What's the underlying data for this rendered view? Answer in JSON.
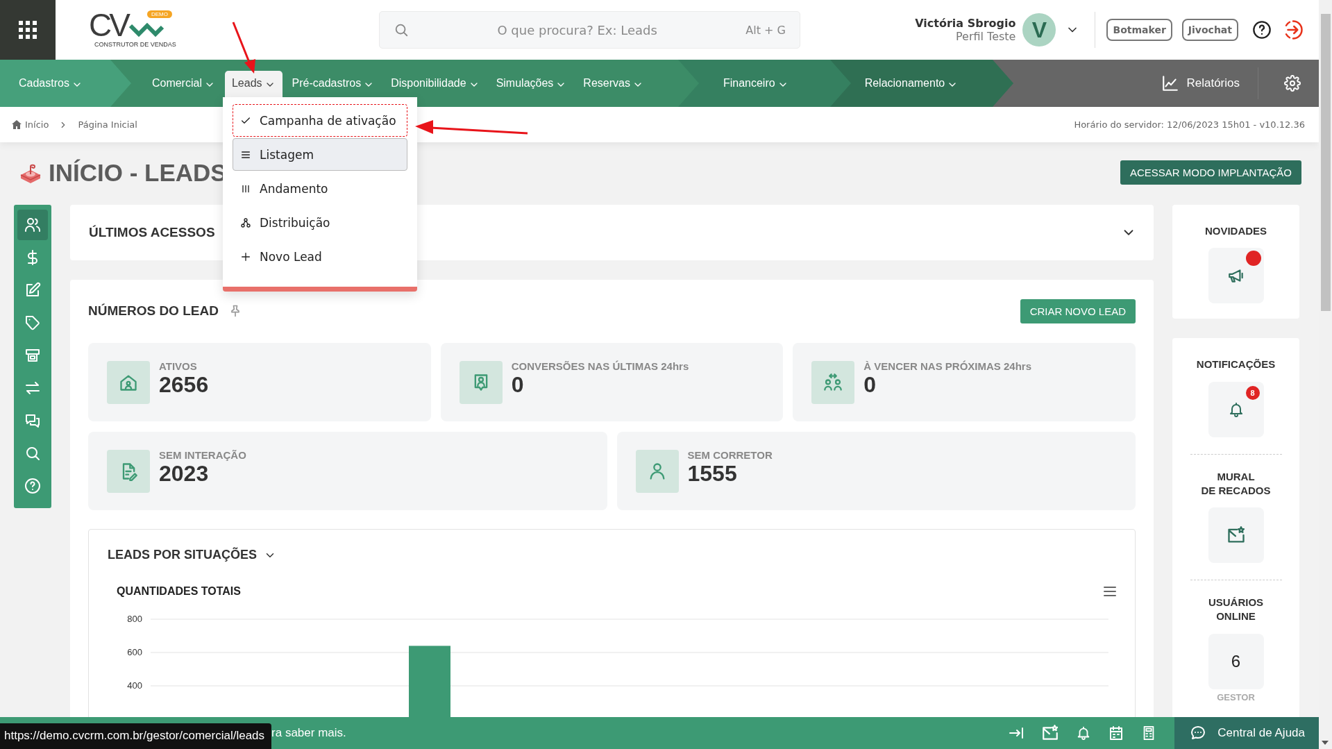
{
  "header": {
    "logo": {
      "letters": "CV",
      "badge": "DEMO",
      "tagline": "CONSTRUTOR DE VENDAS"
    },
    "search": {
      "placeholder": "O que procura? Ex: Leads",
      "shortcut": "Alt + G"
    },
    "user": {
      "name": "Victória Sbrogio",
      "profile": "Perfil Teste",
      "initial": "V"
    },
    "buttons": [
      "Botmaker",
      "Jivochat"
    ]
  },
  "nav": {
    "groups": [
      {
        "items": [
          {
            "label": "Cadastros",
            "selected": false
          }
        ]
      },
      {
        "items": [
          {
            "label": "Comercial",
            "selected": false
          },
          {
            "label": "Leads",
            "selected": true
          },
          {
            "label": "Pré-cadastros",
            "selected": false
          },
          {
            "label": "Disponibilidade",
            "selected": false
          },
          {
            "label": "Simulações",
            "selected": false
          },
          {
            "label": "Reservas",
            "selected": false
          }
        ]
      },
      {
        "items": [
          {
            "label": "Financeiro",
            "selected": false
          }
        ]
      },
      {
        "items": [
          {
            "label": "Relacionamento",
            "selected": false
          }
        ]
      }
    ],
    "reports": "Relatórios"
  },
  "leads_menu": {
    "items": [
      {
        "label": "Campanha de ativação",
        "selected": false,
        "focused": true
      },
      {
        "label": "Listagem",
        "selected": true,
        "focused": false
      },
      {
        "label": "Andamento",
        "selected": false,
        "focused": false
      },
      {
        "label": "Distribuição",
        "selected": false,
        "focused": false
      },
      {
        "label": "Novo Lead",
        "selected": false,
        "focused": false
      }
    ]
  },
  "breadcrumb": [
    "Início",
    "Página Inicial"
  ],
  "server_time": "Horário do servidor: 12/06/2023 15h01 - v10.12.36",
  "page_title": "INÍCIO - LEADS",
  "implant_button": "ACESSAR MODO IMPLANTAÇÃO",
  "sidebar": {
    "items": [
      {
        "selected": true
      },
      {
        "selected": false
      },
      {
        "selected": false
      },
      {
        "selected": false
      },
      {
        "selected": false
      },
      {
        "selected": false
      },
      {
        "selected": false
      },
      {
        "selected": false
      },
      {
        "selected": false
      }
    ]
  },
  "recent": {
    "title": "ÚLTIMOS ACESSOS",
    "expanded": false
  },
  "numbers": {
    "title": "NÚMEROS DO LEAD",
    "button": "CRIAR NOVO LEAD",
    "rows": [
      [
        {
          "label": "ATIVOS",
          "value": "2656"
        },
        {
          "label": "CONVERSÕES NAS ÚLTIMAS 24hrs",
          "value": "0"
        },
        {
          "label": "À VENCER NAS PRÓXIMAS 24hrs",
          "value": "0"
        }
      ],
      [
        {
          "label": "SEM INTERAÇÃO",
          "value": "2023"
        },
        {
          "label": "SEM CORRETOR",
          "value": "1555"
        }
      ]
    ]
  },
  "situations": {
    "title": "LEADS POR SITUAÇÕES",
    "chart_data": {
      "type": "bar",
      "title": "QUANTIDADES TOTAIS",
      "ylim": [
        400,
        800
      ],
      "yticks": [
        400,
        600,
        800
      ],
      "values": [
        640
      ]
    }
  },
  "side_panels": {
    "news": {
      "title": "NOVIDADES",
      "unread": true
    },
    "notifications": {
      "title": "NOTIFICAÇÕES",
      "count": "8"
    },
    "wall": {
      "title": "MURAL\nDE RECADOS"
    },
    "online": {
      "title": "USUÁRIOS\nONLINE",
      "count": "6",
      "group": "GESTOR"
    }
  },
  "footer": {
    "status_url": "https://demo.cvcrm.com.br/gestor/comercial/leads",
    "message": "ra saber mais.",
    "help": "Central de Ajuda"
  }
}
